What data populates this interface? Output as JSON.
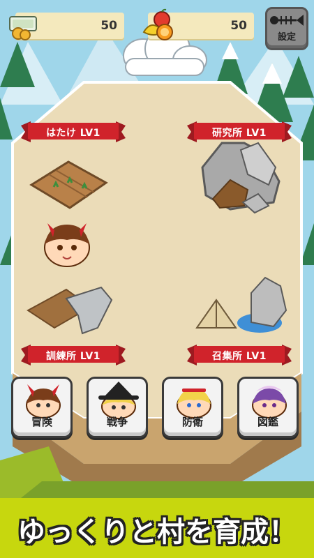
{
  "resources": {
    "money": {
      "icon": "money-icon",
      "value": "50"
    },
    "food": {
      "icon": "fruit-icon",
      "value": "50"
    }
  },
  "settings": {
    "label": "設定",
    "icon": "fish-bone-icon"
  },
  "areas": {
    "field": {
      "label": "はたけ LV1"
    },
    "lab": {
      "label": "研究所 LV1"
    },
    "training": {
      "label": "訓練所 LV1"
    },
    "recruit": {
      "label": "召集所 LV1"
    }
  },
  "menu": [
    {
      "label": "冒険"
    },
    {
      "label": "戦争"
    },
    {
      "label": "防衛"
    },
    {
      "label": "図鑑"
    }
  ],
  "banner": {
    "text": "ゆっくりと村を育成！"
  },
  "colors": {
    "sky": "#9fd6ea",
    "ground": "#ebdcb8",
    "ribbon": "#d0232b",
    "banner": "#c7d70e",
    "resource_box": "#f4e9bd"
  }
}
